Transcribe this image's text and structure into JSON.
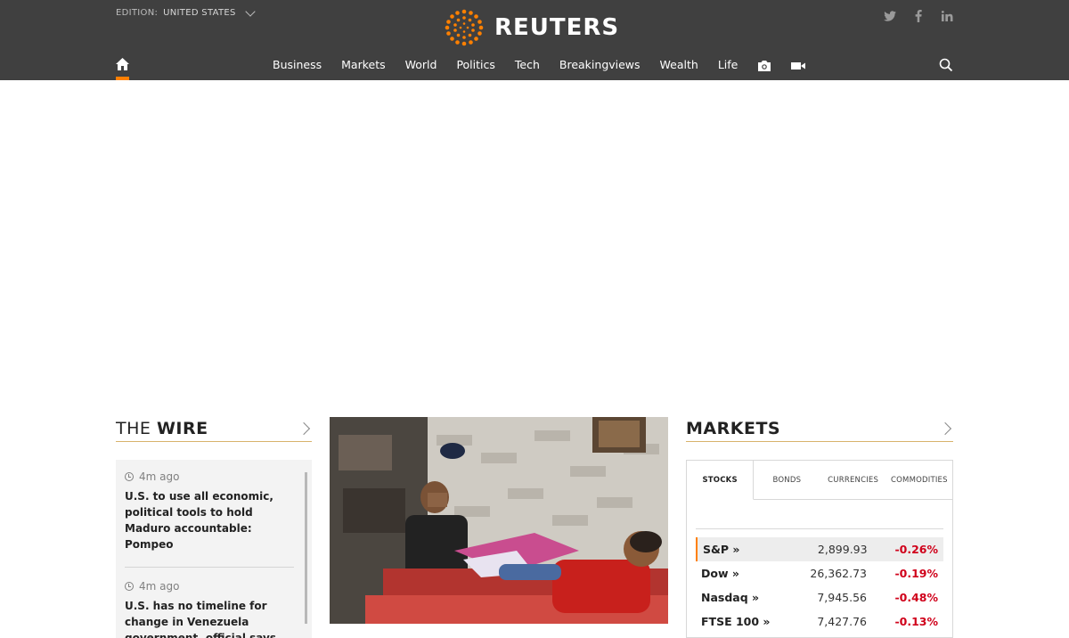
{
  "header": {
    "edition_label": "EDITION:",
    "edition_value": "UNITED STATES",
    "brand": "REUTERS",
    "brand_color": "#ff8000",
    "social_icons": [
      "twitter-icon",
      "facebook-icon",
      "linkedin-icon"
    ]
  },
  "nav": {
    "items": [
      {
        "label": "Business"
      },
      {
        "label": "Markets"
      },
      {
        "label": "World"
      },
      {
        "label": "Politics"
      },
      {
        "label": "Tech"
      },
      {
        "label": "Breakingviews"
      },
      {
        "label": "Wealth"
      },
      {
        "label": "Life"
      }
    ],
    "icons": [
      "home-icon",
      "camera-icon",
      "video-icon",
      "search-icon"
    ]
  },
  "wire": {
    "title_light": "THE",
    "title_bold": "WIRE",
    "items": [
      {
        "time": "4m ago",
        "headline": "U.S. to use all economic, political tools to hold Maduro accountable: Pompeo"
      },
      {
        "time": "4m ago",
        "headline": "U.S. has no timeline for change in Venezuela government, official says"
      }
    ]
  },
  "markets": {
    "title": "MARKETS",
    "tabs": [
      "STOCKS",
      "BONDS",
      "CURRENCIES",
      "COMMODITIES"
    ],
    "active_tab": "STOCKS",
    "rows": [
      {
        "name": "S&P »",
        "value": "2,899.93",
        "change": "-0.26%"
      },
      {
        "name": "Dow »",
        "value": "26,362.73",
        "change": "-0.19%"
      },
      {
        "name": "Nasdaq »",
        "value": "7,945.56",
        "change": "-0.48%"
      },
      {
        "name": "FTSE 100 »",
        "value": "7,427.76",
        "change": "-0.13%"
      }
    ],
    "negative_color": "#d0021b"
  }
}
